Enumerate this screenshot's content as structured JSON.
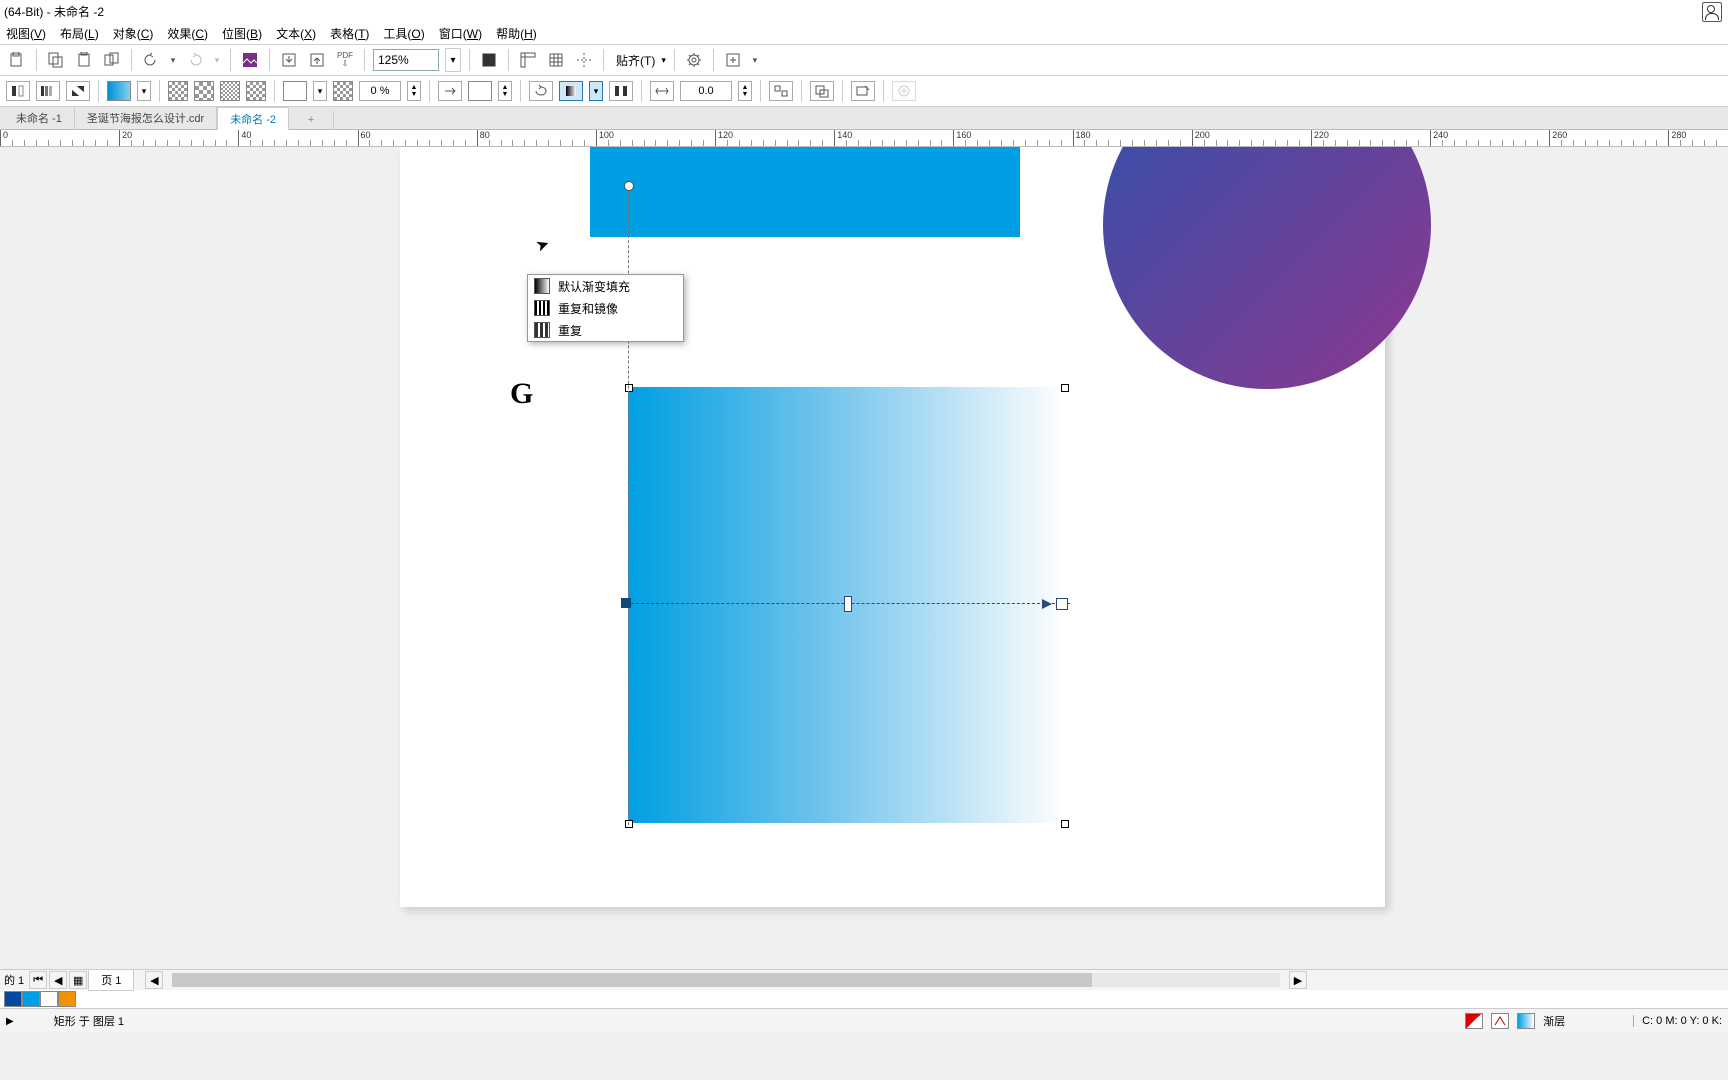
{
  "title": "(64-Bit) - 未命名 -2",
  "menu": [
    "视图(V)",
    "布局(L)",
    "对象(C)",
    "效果(C)",
    "位图(B)",
    "文本(X)",
    "表格(T)",
    "工具(O)",
    "窗口(W)",
    "帮助(H)"
  ],
  "zoom": "125%",
  "snap_label": "贴齐(T)",
  "prop_number1": "0 %",
  "prop_number2": "0.0",
  "tab_items": [
    "未命名 -1",
    "圣诞节海报怎么设计.cdr",
    "未命名 -2"
  ],
  "active_tab": 2,
  "ruler_ticks": [
    0,
    50,
    100,
    150,
    200,
    250,
    300,
    350,
    400,
    450,
    500,
    550,
    600,
    650,
    700,
    750
  ],
  "ruler_labels": [
    0,
    20,
    40,
    60,
    80,
    100,
    120,
    140,
    160,
    180,
    200,
    220,
    240,
    260,
    280
  ],
  "dropdown_items": [
    "默认渐变填充",
    "重复和镜像",
    "重复"
  ],
  "canvas_text": "G",
  "page_label_prefix": "的 1",
  "page_label": "页 1",
  "status_object": "矩形 于 图层 1",
  "status_fill": "渐层",
  "status_coords": "C: 0 M: 0 Y: 0 K:",
  "color_swatches": [
    "#004a9f",
    "#009fe3",
    "#ffffff",
    "#f39200"
  ]
}
